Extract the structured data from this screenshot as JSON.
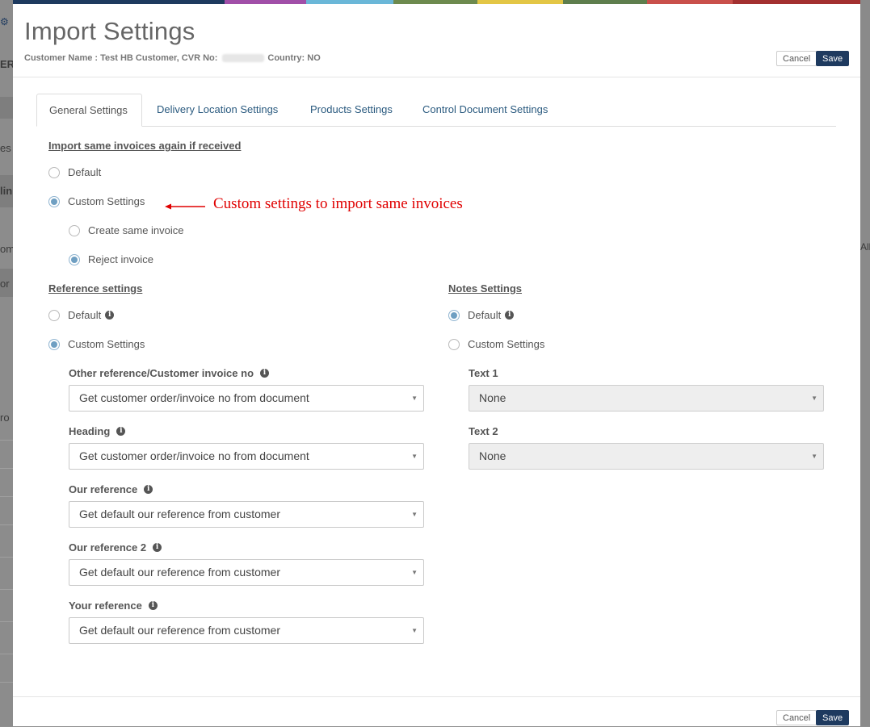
{
  "colors": {
    "topbar": [
      "#1e3a5f",
      "#a14fa8",
      "#6ab7d8",
      "#6d8a4e",
      "#e3c645",
      "#5e7e4d",
      "#c9504b",
      "#a33030"
    ],
    "save_bg": "#1e3a5f",
    "annotation": "#e00000",
    "radio_on": "#6f9fc2"
  },
  "background": {
    "frag_er": "ER",
    "frag_es": "es",
    "frag_lin": "lin",
    "frag_om": "om",
    "frag_or": "or",
    "frag_ro": "ro",
    "frag_all": "All"
  },
  "modal": {
    "title": "Import Settings",
    "subtitle": {
      "customer_label": "Customer Name : Test HB Customer, CVR No:",
      "country_label": "Country: NO"
    },
    "header_buttons": {
      "cancel": "Cancel",
      "save": "Save"
    },
    "footer_buttons": {
      "cancel": "Cancel",
      "save": "Save"
    }
  },
  "tabs": [
    {
      "label": "General Settings",
      "active": true
    },
    {
      "label": "Delivery Location Settings",
      "active": false
    },
    {
      "label": "Products Settings",
      "active": false
    },
    {
      "label": "Control Document Settings",
      "active": false
    }
  ],
  "import_same": {
    "title": "Import same invoices again if received",
    "default": "Default",
    "custom": "Custom Settings",
    "create_same": "Create same invoice",
    "reject": "Reject invoice",
    "annotation": "Custom settings to import same invoices"
  },
  "reference": {
    "title": "Reference settings",
    "default": "Default",
    "custom": "Custom Settings",
    "fields": [
      {
        "label": "Other reference/Customer invoice no",
        "value": "Get customer order/invoice no from document"
      },
      {
        "label": "Heading",
        "value": "Get customer order/invoice no from document"
      },
      {
        "label": "Our reference",
        "value": "Get default our reference from customer"
      },
      {
        "label": "Our reference 2",
        "value": "Get default our reference from customer"
      },
      {
        "label": "Your reference",
        "value": "Get default our reference from customer"
      }
    ]
  },
  "notes": {
    "title": "Notes Settings",
    "default": "Default",
    "custom": "Custom Settings",
    "fields": [
      {
        "label": "Text 1",
        "value": "None"
      },
      {
        "label": "Text 2",
        "value": "None"
      }
    ]
  },
  "icons": {
    "info": "info-icon",
    "caret": "chevron-down-icon",
    "arrow": "arrow-left-icon"
  }
}
